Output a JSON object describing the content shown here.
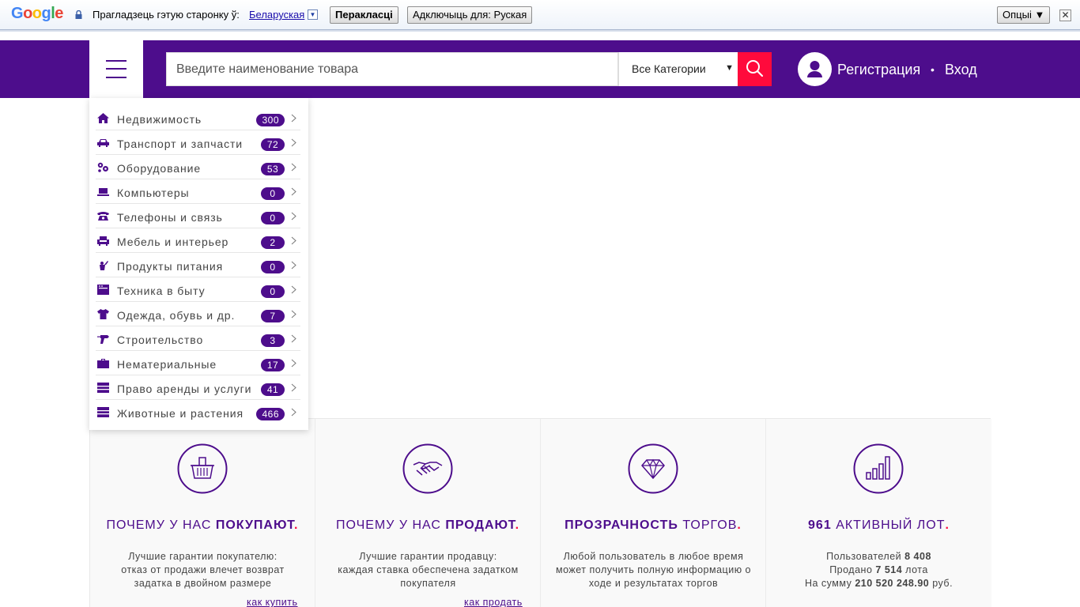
{
  "translate_bar": {
    "logo": "Google",
    "prompt": "Прагладзець гэтую старонку ў:",
    "language": "Беларуская",
    "translate_button": "Перакласці",
    "disable_button": "Адключыць для: Руская",
    "options_button": "Опцыі ▼",
    "close": "✕"
  },
  "header": {
    "search_placeholder": "Введите наименование товара",
    "category_select": "Все Категории",
    "register": "Регистрация",
    "separator": "•",
    "login": "Вход"
  },
  "categories": [
    {
      "label": "Недвижимость",
      "count": "300",
      "icon": "house-icon"
    },
    {
      "label": "Транспорт и запчасти",
      "count": "72",
      "icon": "car-icon"
    },
    {
      "label": "Оборудование",
      "count": "53",
      "icon": "gears-icon"
    },
    {
      "label": "Компьютеры",
      "count": "0",
      "icon": "laptop-icon"
    },
    {
      "label": "Телефоны и связь",
      "count": "0",
      "icon": "phone-icon"
    },
    {
      "label": "Мебель и интерьер",
      "count": "2",
      "icon": "armchair-icon"
    },
    {
      "label": "Продукты питания",
      "count": "0",
      "icon": "food-icon"
    },
    {
      "label": "Техника в быту",
      "count": "0",
      "icon": "appliance-icon"
    },
    {
      "label": "Одежда, обувь и др.",
      "count": "7",
      "icon": "tshirt-icon"
    },
    {
      "label": "Строительство",
      "count": "3",
      "icon": "drill-icon"
    },
    {
      "label": "Нематериальные",
      "count": "17",
      "icon": "briefcase-icon"
    },
    {
      "label": "Право аренды и услуги",
      "count": "41",
      "icon": "document-icon"
    },
    {
      "label": "Животные и растения",
      "count": "466",
      "icon": "document-icon"
    }
  ],
  "features": [
    {
      "title_light": "Почему у нас",
      "title_bold": "покупают",
      "dot": ".",
      "lines": [
        "Лучшие гарантии покупателю:",
        "отказ от продажи влечет возврат",
        "задатка в двойном размере"
      ],
      "link": "как купить",
      "icon": "basket-icon"
    },
    {
      "title_light": "Почему у нас",
      "title_bold": "продают",
      "dot": ".",
      "lines": [
        "Лучшие гарантии продавцу:",
        "каждая ставка обеспечена задатком",
        "покупателя"
      ],
      "link": "как продать",
      "icon": "handshake-icon"
    },
    {
      "title_bold": "Прозрачность",
      "title_light": "торгов",
      "dot": ".",
      "lines": [
        "Любой пользователь в любое время",
        "может получить полную информацию о",
        "ходе и результатах торгов"
      ],
      "icon": "diamond-icon"
    },
    {
      "title_bold": "961",
      "title_light": "активный лот",
      "dot": ".",
      "stats": [
        {
          "pre": "Пользователей",
          "value": "8 408",
          "post": ""
        },
        {
          "pre": "Продано",
          "value": "7 514",
          "post": "лота"
        },
        {
          "pre": "На сумму",
          "value": "210 520 248.90",
          "post": "руб."
        }
      ],
      "icon": "bar-chart-icon"
    }
  ],
  "colors": {
    "brand": "#4d0d8c",
    "accent": "#ff0a3c"
  }
}
